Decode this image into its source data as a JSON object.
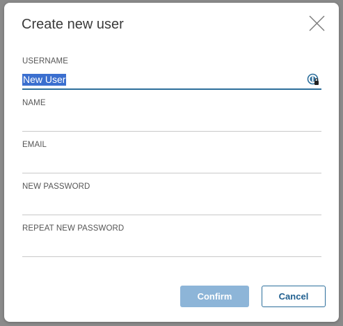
{
  "dialog": {
    "title": "Create new user",
    "close_icon": "close-icon"
  },
  "form": {
    "fields": [
      {
        "label": "USERNAME",
        "value": "New User",
        "focused": true,
        "selected_text": true
      },
      {
        "label": "NAME",
        "value": ""
      },
      {
        "label": "EMAIL",
        "value": ""
      },
      {
        "label": "NEW PASSWORD",
        "value": ""
      },
      {
        "label": "REPEAT NEW PASSWORD",
        "value": ""
      }
    ],
    "password_manager_icon": "password-manager-icon"
  },
  "actions": {
    "confirm_label": "Confirm",
    "cancel_label": "Cancel",
    "confirm_disabled": true
  },
  "colors": {
    "accent": "#2c6e9b",
    "confirm_bg": "#8db5d8",
    "selection": "#3b6fcf",
    "overlay": "#8a8a8a"
  }
}
